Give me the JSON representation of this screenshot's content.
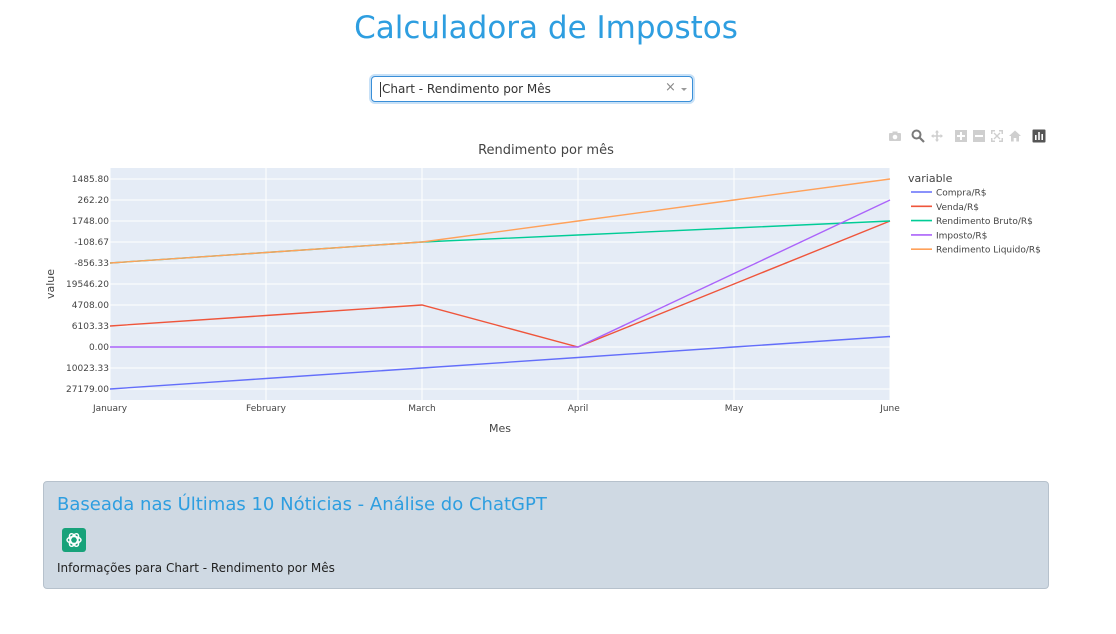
{
  "page": {
    "title": "Calculadora de Impostos"
  },
  "dropdown": {
    "value": "Chart - Rendimento por Mês",
    "clear": "×"
  },
  "news": {
    "title": "Baseada nas Últimas 10 Nóticias - Análise do ChatGPT",
    "text": "Informações para Chart - Rendimento por Mês"
  },
  "modebar": {
    "icons": [
      "camera-icon",
      "zoom-icon",
      "pan-icon",
      "zoom-in-icon",
      "zoom-out-icon",
      "autoscale-icon",
      "home-icon",
      "plotly-logo-icon"
    ]
  },
  "chart_data": {
    "type": "line",
    "title": "Rendimento por mês",
    "xlabel": "Mes",
    "ylabel": "value",
    "legend_title": "variable",
    "legend_position": "right",
    "grid": true,
    "categories": [
      "January",
      "February",
      "March",
      "April",
      "May",
      "June"
    ],
    "y_ticks": [
      "1485.80",
      "262.20",
      "1748.00",
      "-108.67",
      "-856.33",
      "19546.20",
      "4708.00",
      "6103.33",
      "0.00",
      "10023.33",
      "27179.00"
    ],
    "series": [
      {
        "name": "Compra/R$",
        "color": "#636efa",
        "values": [
          27179.0,
          19012,
          10023.33,
          4400,
          0.0,
          -3500
        ]
      },
      {
        "name": "Venda/R$",
        "color": "#ef553b",
        "values": [
          6103.33,
          5210,
          4708.0,
          0.0,
          19546.2,
          24700
        ]
      },
      {
        "name": "Rendimento Bruto/R$",
        "color": "#00cc96",
        "values": [
          -856.33,
          -473,
          -108.67,
          241,
          1209,
          1748.0
        ]
      },
      {
        "name": "Imposto/R$",
        "color": "#ab63fa",
        "values": [
          0.0,
          0.0,
          0.0,
          0.0,
          245,
          262.2
        ]
      },
      {
        "name": "Rendimento Liquido/R$",
        "color": "#ffa15a",
        "values": [
          -856.33,
          -473,
          -108.67,
          241,
          1320,
          1485.8
        ]
      }
    ]
  }
}
